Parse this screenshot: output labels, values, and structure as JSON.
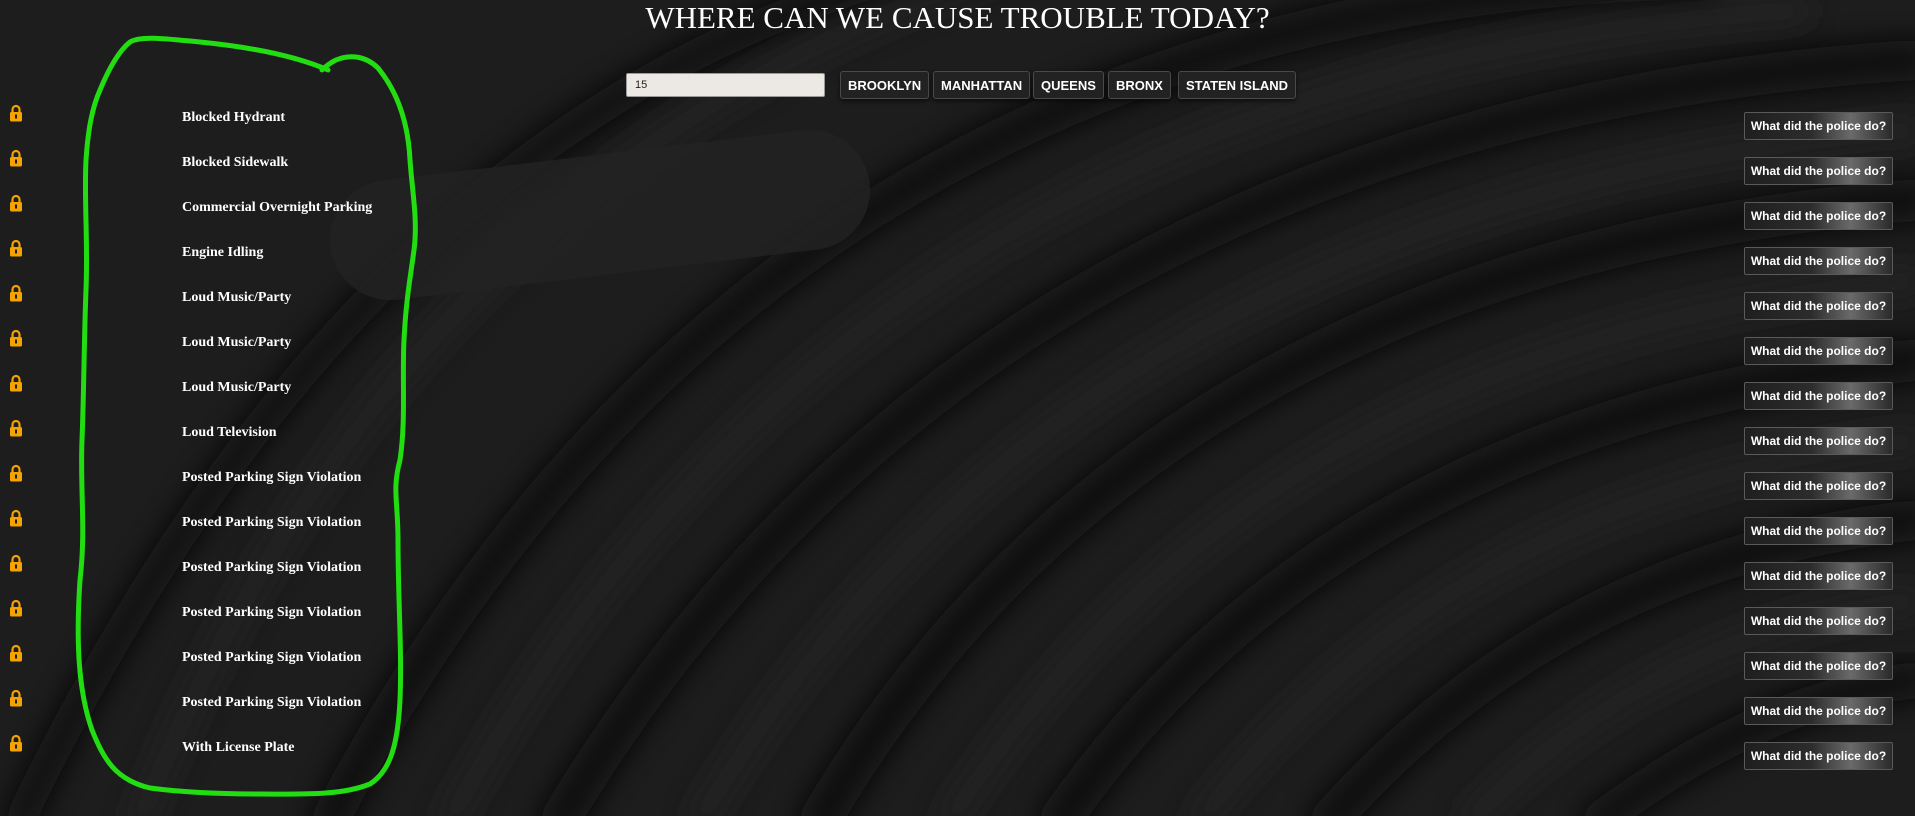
{
  "page": {
    "title": "WHERE CAN WE CAUSE TROUBLE TODAY?"
  },
  "search": {
    "value": "15"
  },
  "boroughs": [
    "BROOKLYN",
    "MANHATTAN",
    "QUEENS",
    "BRONX",
    "STATEN ISLAND"
  ],
  "complaints": [
    {
      "label": "Blocked Hydrant",
      "action": "What did the police do?"
    },
    {
      "label": "Blocked Sidewalk",
      "action": "What did the police do?"
    },
    {
      "label": "Commercial Overnight Parking",
      "action": "What did the police do?"
    },
    {
      "label": "Engine Idling",
      "action": "What did the police do?"
    },
    {
      "label": "Loud Music/Party",
      "action": "What did the police do?"
    },
    {
      "label": "Loud Music/Party",
      "action": "What did the police do?"
    },
    {
      "label": "Loud Music/Party",
      "action": "What did the police do?"
    },
    {
      "label": "Loud Television",
      "action": "What did the police do?"
    },
    {
      "label": "Posted Parking Sign Violation",
      "action": "What did the police do?"
    },
    {
      "label": "Posted Parking Sign Violation",
      "action": "What did the police do?"
    },
    {
      "label": "Posted Parking Sign Violation",
      "action": "What did the police do?"
    },
    {
      "label": "Posted Parking Sign Violation",
      "action": "What did the police do?"
    },
    {
      "label": "Posted Parking Sign Violation",
      "action": "What did the police do?"
    },
    {
      "label": "Posted Parking Sign Violation",
      "action": "What did the police do?"
    },
    {
      "label": "With License Plate",
      "action": "What did the police do?"
    }
  ],
  "icons": {
    "row_icon": "lock-icon"
  },
  "colors": {
    "background": "#1c1c1c",
    "lock": "#f5a300",
    "annotation": "#22dd11"
  }
}
